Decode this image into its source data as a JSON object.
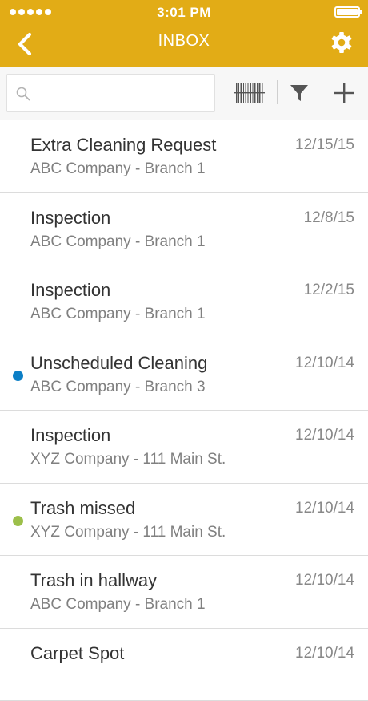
{
  "status_bar": {
    "time": "3:01 PM"
  },
  "nav": {
    "title": "INBOX"
  },
  "search": {
    "placeholder": "",
    "value": ""
  },
  "items": [
    {
      "title": "Extra Cleaning Request",
      "subtitle": "ABC Company - Branch 1",
      "date": "12/15/15",
      "dot": null
    },
    {
      "title": "Inspection",
      "subtitle": "ABC Company - Branch 1",
      "date": "12/8/15",
      "dot": null
    },
    {
      "title": "Inspection",
      "subtitle": "ABC Company - Branch 1",
      "date": "12/2/15",
      "dot": null
    },
    {
      "title": "Unscheduled Cleaning",
      "subtitle": "ABC Company - Branch 3",
      "date": "12/10/14",
      "dot": "#0c7fc6"
    },
    {
      "title": "Inspection",
      "subtitle": "XYZ Company - 111 Main St.",
      "date": "12/10/14",
      "dot": null
    },
    {
      "title": "Trash missed",
      "subtitle": "XYZ Company - 111 Main St.",
      "date": "12/10/14",
      "dot": "#9cbf4a"
    },
    {
      "title": "Trash in hallway",
      "subtitle": "ABC Company - Branch 1",
      "date": "12/10/14",
      "dot": null
    },
    {
      "title": "Carpet Spot",
      "subtitle": "",
      "date": "12/10/14",
      "dot": null
    }
  ],
  "colors": {
    "header": "#e2ac16",
    "unread_blue": "#0c7fc6",
    "unread_green": "#9cbf4a"
  }
}
